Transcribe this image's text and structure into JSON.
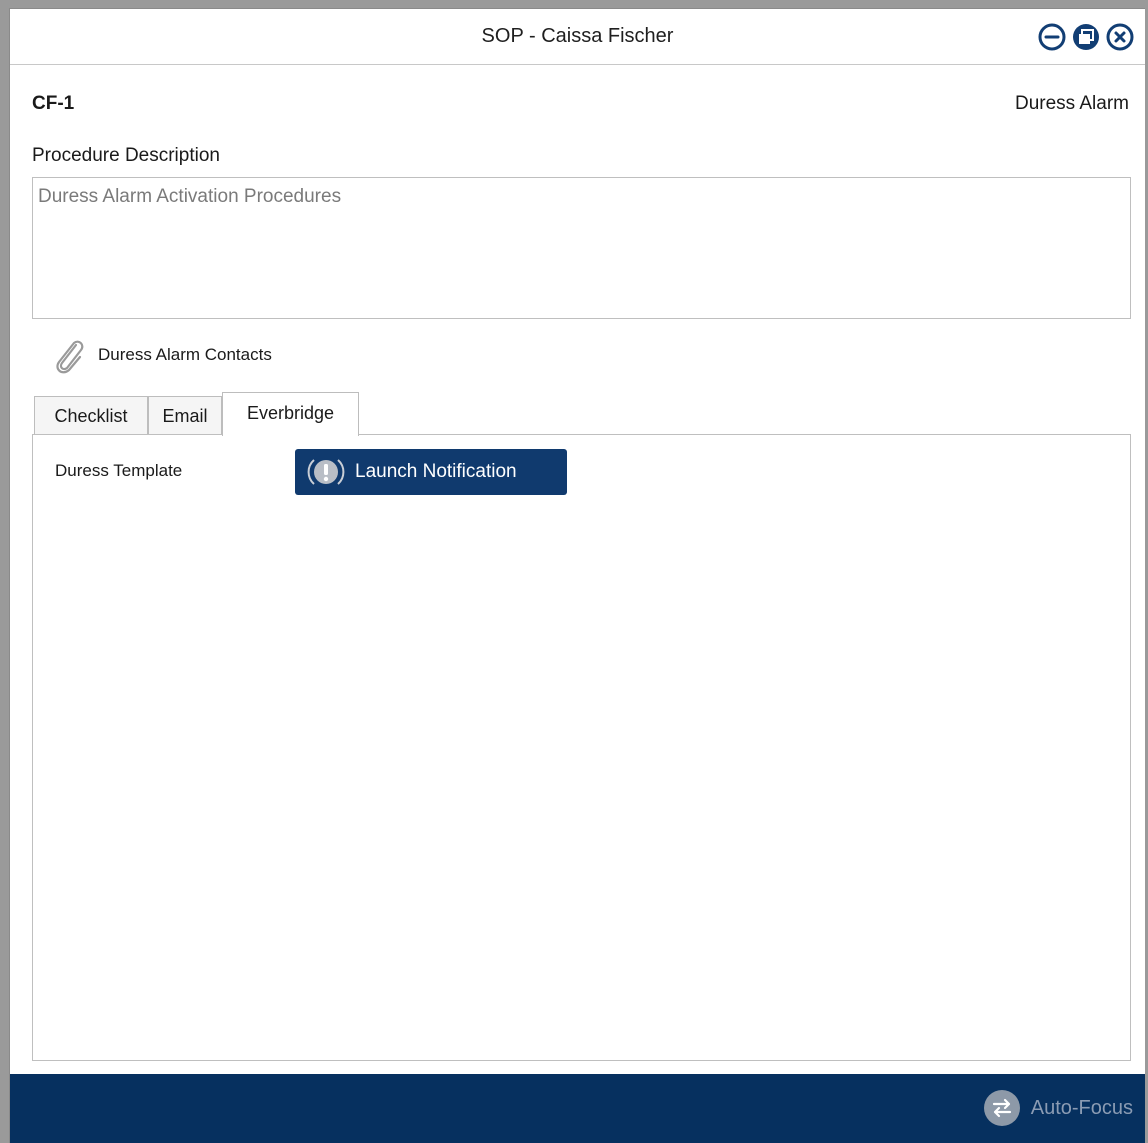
{
  "window": {
    "title": "SOP - Caissa Fischer",
    "controls": [
      "minimize-icon",
      "restore-icon",
      "close-icon"
    ]
  },
  "header": {
    "code": "CF-1",
    "type": "Duress Alarm"
  },
  "description": {
    "heading": "Procedure Description",
    "text": "Duress Alarm Activation Procedures"
  },
  "attachment": {
    "icon": "paperclip-icon",
    "label": "Duress Alarm Contacts"
  },
  "tabs": [
    {
      "label": "Checklist",
      "active": false
    },
    {
      "label": "Email",
      "active": false
    },
    {
      "label": "Everbridge",
      "active": true
    }
  ],
  "everbridge": {
    "template_label": "Duress Template",
    "launch_button": {
      "icon": "alert-icon",
      "label": "Launch Notification"
    }
  },
  "footer": {
    "autofocus": {
      "icon": "swap-icon",
      "label": "Auto-Focus"
    }
  },
  "colors": {
    "primary_navy": "#103a6e",
    "footer_bg": "#06305f",
    "window_controls": "#123e74",
    "autofocus_text": "#8a9bb3"
  }
}
